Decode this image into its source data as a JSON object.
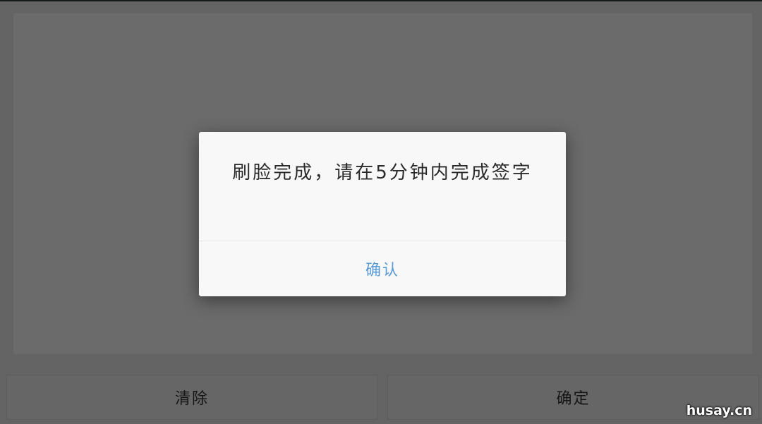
{
  "bottom_bar": {
    "clear_label": "清除",
    "confirm_label": "确定"
  },
  "dialog": {
    "message": "刷脸完成，请在5分钟内完成签字",
    "confirm_label": "确认"
  },
  "watermark": "husay.cn",
  "colors": {
    "confirm_text": "#5b9bd5",
    "overlay": "rgba(0,0,0,0.58)",
    "dialog_bg": "#f8f8f8"
  }
}
